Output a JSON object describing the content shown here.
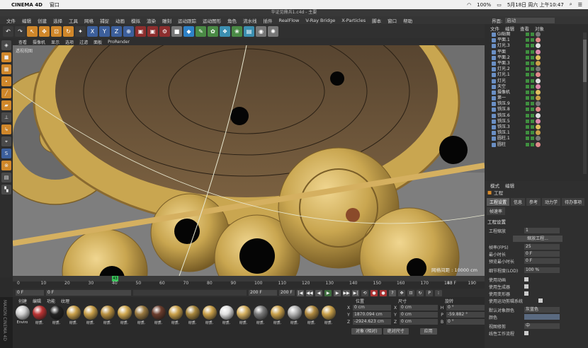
{
  "mac": {
    "app": "CINEMA 4D",
    "window_menu": "窗口",
    "battery": "100%",
    "datetime": "5月18日 周六 上午10:47"
  },
  "title": "华证见鼎兵1.c4d - 主要",
  "menu": [
    "文件",
    "编辑",
    "创建",
    "选择",
    "工具",
    "网格",
    "捕捉",
    "动画",
    "模拟",
    "渲染",
    "雕刻",
    "运动跟踪",
    "运动图形",
    "角色",
    "流水线",
    "插件",
    "RealFlow",
    "V-Ray Bridge",
    "X-Particles",
    "脚本",
    "窗口",
    "帮助"
  ],
  "interface": {
    "label": "界面:",
    "value": "启动"
  },
  "viewport_menu": [
    "查看",
    "摄像机",
    "显示",
    "选项",
    "过滤",
    "面板",
    "ProRender"
  ],
  "viewport": {
    "label": "透视视图",
    "grid": "网格间距 : 10000 cm"
  },
  "timeline": {
    "ticks": [
      "0",
      "10",
      "20",
      "30",
      "40",
      "50",
      "60",
      "70",
      "80",
      "90",
      "100",
      "110",
      "120",
      "130",
      "140",
      "150",
      "160",
      "170",
      "180",
      "190"
    ],
    "current": "43",
    "frame_display": "43 F"
  },
  "playbar": {
    "start": "0 F",
    "min": "0 F",
    "max": "200 F",
    "end": "200 F"
  },
  "materials": {
    "tabs": [
      "创建",
      "编辑",
      "功能",
      "纹理"
    ],
    "items": [
      {
        "label": "Enviro",
        "color": "#cfcfcf"
      },
      {
        "label": "材质.",
        "color": "#b33"
      },
      {
        "label": "材质.",
        "color": "#222"
      },
      {
        "label": "材质.",
        "color": "#c9a04a"
      },
      {
        "label": "材质.",
        "color": "#c9a04a"
      },
      {
        "label": "材质.",
        "color": "#b89040"
      },
      {
        "label": "材质.",
        "color": "#d0a850"
      },
      {
        "label": "材质.",
        "color": "#9a7a40"
      },
      {
        "label": "材质.",
        "color": "#6a3c2c"
      },
      {
        "label": "材质.",
        "color": "#c9a04a"
      },
      {
        "label": "材质.",
        "color": "#a7863c"
      },
      {
        "label": "材质.",
        "color": "#c9a04a"
      },
      {
        "label": "材质.",
        "color": "#e0e0e0"
      },
      {
        "label": "材质.",
        "color": "#d5b060"
      },
      {
        "label": "材质.",
        "color": "#7a7a7a"
      },
      {
        "label": "材质.",
        "color": "#c9a04a"
      },
      {
        "label": "材质.",
        "color": "#b3b3b3"
      },
      {
        "label": "材质.",
        "color": "#b08a40"
      },
      {
        "label": "材质.",
        "color": "#c9a04a"
      }
    ]
  },
  "coords": {
    "headers": [
      "位置",
      "尺寸",
      "旋转"
    ],
    "rows": [
      {
        "pa": "X",
        "pv": "0 cm",
        "sa": "X",
        "sv": "0 cm",
        "ra": "H",
        "rv": "0 °"
      },
      {
        "pa": "Y",
        "pv": "1870.094 cm",
        "sa": "Y",
        "sv": "0 cm",
        "ra": "P",
        "rv": "-59.882 °"
      },
      {
        "pa": "Z",
        "pv": "-2924.623 cm",
        "sa": "Z",
        "sv": "0 cm",
        "ra": "B",
        "rv": "0 °"
      }
    ],
    "mode": "对象 (相对)",
    "size_mode": "绝对尺寸",
    "apply": "应用"
  },
  "objects": {
    "menu": [
      "文件",
      "编辑",
      "查看",
      "对象"
    ],
    "rows": [
      "GI贴图",
      "平面.1",
      "灯光.3",
      "平面",
      "平面.2",
      "平面.3",
      "灯光.2",
      "灯光.1",
      "灯光",
      "天空",
      "摄像机",
      "第一",
      "铁压.9",
      "铁压.8",
      "铁压.6",
      "铁压.5",
      "铁压.3",
      "铁压.1",
      "圆柱.1",
      "圆柱"
    ]
  },
  "attributes": {
    "menu": [
      "模式",
      "编辑"
    ],
    "title": "工程",
    "tabs": [
      "工程设置",
      "信息",
      "参考",
      "动力学",
      "待办事项",
      "帧速率"
    ],
    "section": "工程设置",
    "scale_label": "工程缩放",
    "scale_value": "1",
    "scale_btn": "缩放工程...",
    "fps_label": "帧率(FPS)",
    "fps": "25",
    "min_label": "最小时长",
    "min": "0 F",
    "preview_min_label": "预览最小时长",
    "preview_min": "0 F",
    "lod_label": "细节程度(LOD)",
    "lod": "100 %",
    "anim_label": "使用动画",
    "gen_label": "使用生成器",
    "deform_label": "使用变形器",
    "motion_label": "使用运动剪辑系统",
    "objcolor_label": "默认对象颜色",
    "objcolor": "灰蓝色",
    "color_label": "颜色",
    "view_label": "视图修剪",
    "view_val": "中",
    "linear_label": "线性工作流程"
  }
}
